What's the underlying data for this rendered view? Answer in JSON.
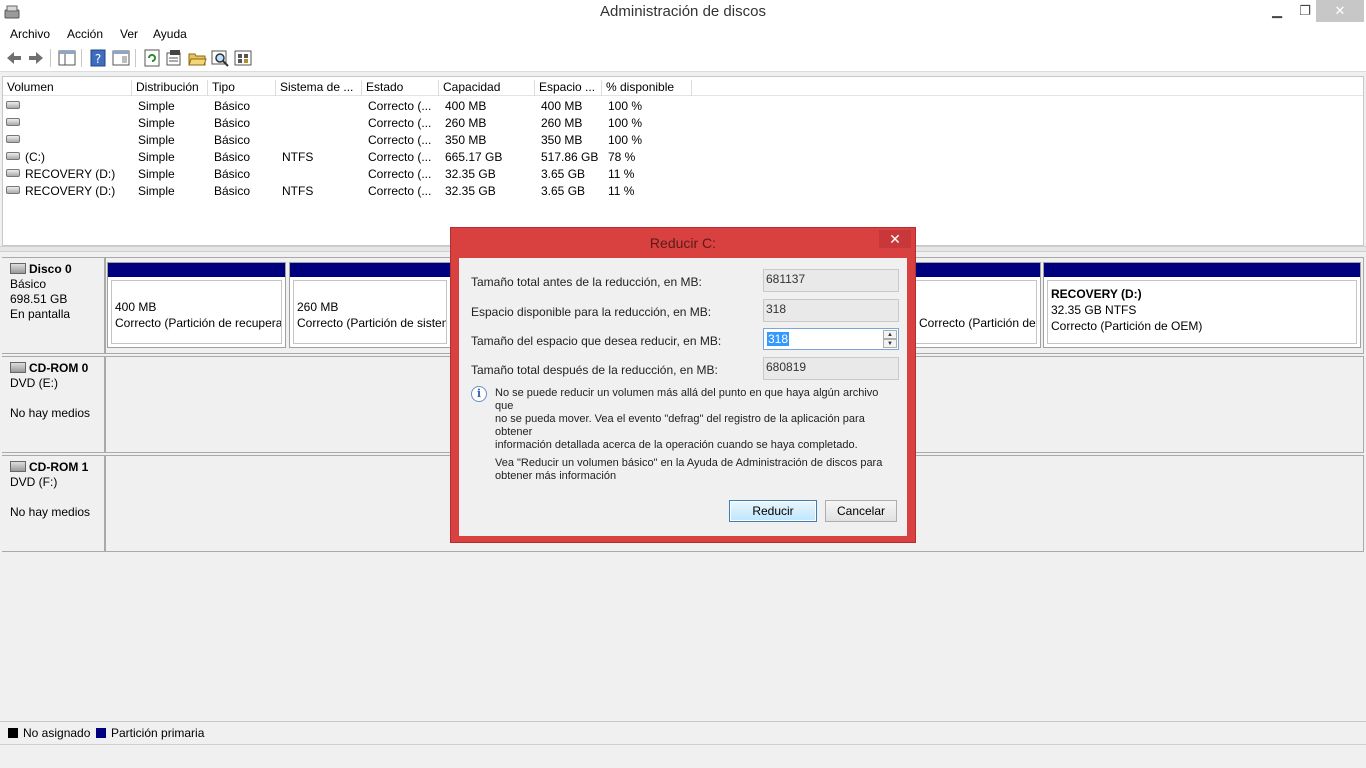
{
  "window": {
    "title": "Administración de discos"
  },
  "menu": [
    "Archivo",
    "Acción",
    "Ver",
    "Ayuda"
  ],
  "toolbar": {
    "icons": [
      "back-icon",
      "forward-icon",
      "console-tree-icon",
      "help-icon",
      "show-hide-icon",
      "refresh-icon",
      "properties-icon",
      "open-icon",
      "find-icon",
      "rescan-icon"
    ]
  },
  "volumes": {
    "headers": [
      "Volumen",
      "Distribución",
      "Tipo",
      "Sistema de ...",
      "Estado",
      "Capacidad",
      "Espacio ...",
      "% disponible"
    ],
    "rows": [
      [
        "",
        "Simple",
        "Básico",
        "",
        "Correcto (...",
        "400 MB",
        "400 MB",
        "100 %"
      ],
      [
        "",
        "Simple",
        "Básico",
        "",
        "Correcto (...",
        "260 MB",
        "260 MB",
        "100 %"
      ],
      [
        "",
        "Simple",
        "Básico",
        "",
        "Correcto (...",
        "350 MB",
        "350 MB",
        "100 %"
      ],
      [
        "(C:)",
        "Simple",
        "Básico",
        "NTFS",
        "Correcto (...",
        "665.17 GB",
        "517.86 GB",
        "78 %"
      ],
      [
        "RECOVERY (D:)",
        "Simple",
        "Básico",
        "",
        "Correcto (...",
        "32.35 GB",
        "3.65 GB",
        "11 %"
      ],
      [
        "RECOVERY (D:)",
        "Simple",
        "Básico",
        "NTFS",
        "Correcto (...",
        "32.35 GB",
        "3.65 GB",
        "11 %"
      ]
    ]
  },
  "disks": [
    {
      "name": "Disco 0",
      "line1": "Básico",
      "line2": "698.51 GB",
      "line3": "En pantalla"
    },
    {
      "name": "CD-ROM 0",
      "line1": "DVD (E:)",
      "line2": "",
      "line3": "No hay medios"
    },
    {
      "name": "CD-ROM 1",
      "line1": "DVD (F:)",
      "line2": "",
      "line3": "No hay medios"
    }
  ],
  "partitions": {
    "p1": {
      "title": "",
      "size": "400 MB",
      "status": "Correcto (Partición de recuperación)"
    },
    "p2": {
      "title": "",
      "size": "260 MB",
      "status": "Correcto (Partición de sistema EFI)"
    },
    "p3": {
      "title": "",
      "size": "",
      "status": "Correcto (Partición de recuperación)"
    },
    "p4": {
      "title": "RECOVERY  (D:)",
      "size": "32.35 GB NTFS",
      "status": "Correcto (Partición de OEM)"
    }
  },
  "legend": {
    "unallocated": "No asignado",
    "primary": "Partición primaria"
  },
  "colors": {
    "primary_partition": "#00007f",
    "unallocated": "#000000",
    "dialog_frame": "#d94141"
  },
  "dialog": {
    "title": "Reducir C:",
    "close": "✕",
    "label_total_before": "Tamaño total antes de la reducción, en MB:",
    "value_total_before": "681137",
    "label_available": "Espacio disponible para la reducción, en MB:",
    "value_available": "318",
    "label_reduce": "Tamaño del espacio que desea reducir, en MB:",
    "value_reduce": "318",
    "label_total_after": "Tamaño total después de la reducción, en MB:",
    "value_total_after": "680819",
    "info_line1": "No se puede reducir un volumen más allá del punto en que haya algún archivo que",
    "info_line2": "no se pueda mover. Vea el evento \"defrag\" del registro de la aplicación para obtener",
    "info_line3": "información detallada acerca de la operación cuando se haya completado.",
    "help_line1": "Vea \"Reducir un volumen básico\"  en la Ayuda de Administración de discos para",
    "help_line2": "obtener más información",
    "ok_button": "Reducir",
    "cancel_button": "Cancelar"
  }
}
